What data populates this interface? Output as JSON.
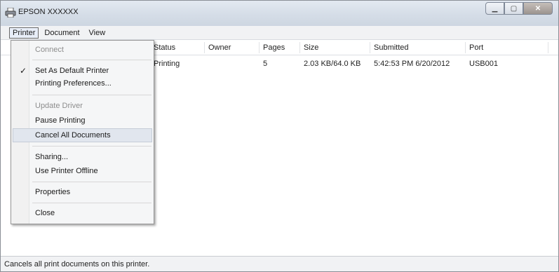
{
  "window": {
    "title": "EPSON XXXXXX"
  },
  "menubar": {
    "items": [
      "Printer",
      "Document",
      "View"
    ]
  },
  "columns": [
    "Status",
    "Owner",
    "Pages",
    "Size",
    "Submitted",
    "Port"
  ],
  "rows": [
    {
      "status": "Printing",
      "owner": "",
      "pages": "5",
      "size": "2.03 KB/64.0 KB",
      "submitted": "5:42:53 PM 6/20/2012",
      "port": "USB001"
    }
  ],
  "printer_menu": {
    "connect": "Connect",
    "set_default": "Set As Default Printer",
    "set_default_checked": "✓",
    "printing_preferences": "Printing Preferences...",
    "update_driver": "Update Driver",
    "pause_printing": "Pause Printing",
    "cancel_all": "Cancel All Documents",
    "sharing": "Sharing...",
    "use_offline": "Use Printer Offline",
    "properties": "Properties",
    "close": "Close"
  },
  "statusbar": {
    "text": "Cancels all print documents on this printer."
  }
}
